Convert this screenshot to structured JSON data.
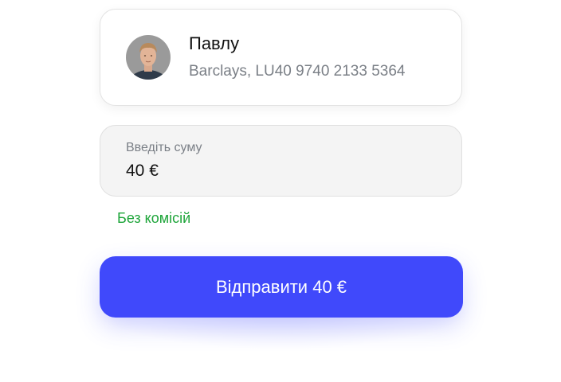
{
  "recipient": {
    "name": "Павлу",
    "account": "Barclays, LU40 9740 2133 5364",
    "avatar_icon": "person-photo-avatar"
  },
  "amount": {
    "label": "Введіть суму",
    "value": "40 €"
  },
  "fee_note": "Без комісій",
  "send_button": {
    "label": "Відправити 40 €"
  },
  "colors": {
    "accent": "#4049fb",
    "fee_green": "#1ea53a",
    "muted_text": "#7a7f86",
    "field_bg": "#f4f4f4"
  }
}
